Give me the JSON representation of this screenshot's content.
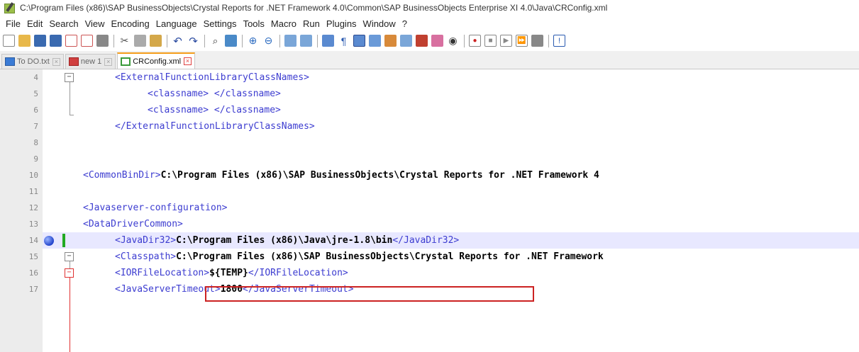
{
  "window": {
    "title": "C:\\Program Files (x86)\\SAP BusinessObjects\\Crystal Reports for .NET Framework 4.0\\Common\\SAP BusinessObjects Enterprise XI 4.0\\Java\\CRConfig.xml"
  },
  "menu": [
    "File",
    "Edit",
    "Search",
    "View",
    "Encoding",
    "Language",
    "Settings",
    "Tools",
    "Macro",
    "Run",
    "Plugins",
    "Window",
    "?"
  ],
  "tabs": [
    {
      "label": "To DO.txt",
      "active": false
    },
    {
      "label": "new 1",
      "active": false
    },
    {
      "label": "CRConfig.xml",
      "active": true
    }
  ],
  "editor": {
    "lines": [
      {
        "num": "4",
        "tag1": "<ExternalFunctionLibraryClassNames>",
        "text": "",
        "tag2": ""
      },
      {
        "num": "5",
        "tag1": "<classname>",
        "text": " ",
        "tag2": "</classname>"
      },
      {
        "num": "6",
        "tag1": "<classname>",
        "text": " ",
        "tag2": "</classname>"
      },
      {
        "num": "7",
        "tag1": "</ExternalFunctionLibraryClassNames>",
        "text": "",
        "tag2": ""
      },
      {
        "num": "8",
        "tag1": "",
        "text": "",
        "tag2": ""
      },
      {
        "num": "9",
        "tag1": "",
        "text": "",
        "tag2": ""
      },
      {
        "num": "10",
        "tag1": "<CommonBinDir>",
        "text": "C:\\Program Files (x86)\\SAP BusinessObjects\\Crystal Reports for .NET Framework 4",
        "tag2": ""
      },
      {
        "num": "11",
        "tag1": "",
        "text": "",
        "tag2": ""
      },
      {
        "num": "12",
        "tag1": "<Javaserver-configuration>",
        "text": "",
        "tag2": ""
      },
      {
        "num": "13",
        "tag1": "<DataDriverCommon>",
        "text": "",
        "tag2": ""
      },
      {
        "num": "14",
        "tag1": "<JavaDir32>",
        "text": "C:\\Program Files (x86)\\Java\\jre-1.8\\bin",
        "tag2": "</JavaDir32>"
      },
      {
        "num": "15",
        "tag1": "<Classpath>",
        "text": "C:\\Program Files (x86)\\SAP BusinessObjects\\Crystal Reports for .NET Framework",
        "tag2": ""
      },
      {
        "num": "16",
        "tag1": "<IORFileLocation>",
        "text": "${TEMP}",
        "tag2": "</IORFileLocation>"
      },
      {
        "num": "17",
        "tag1": "<JavaServerTimeout>",
        "text": "1800",
        "tag2": "</JavaServerTimeout>"
      }
    ]
  },
  "colors": {
    "tag": "#3c3cd0",
    "text": "#000000",
    "highlight": "#c22222",
    "active_tab_accent": "#f49d1a"
  }
}
